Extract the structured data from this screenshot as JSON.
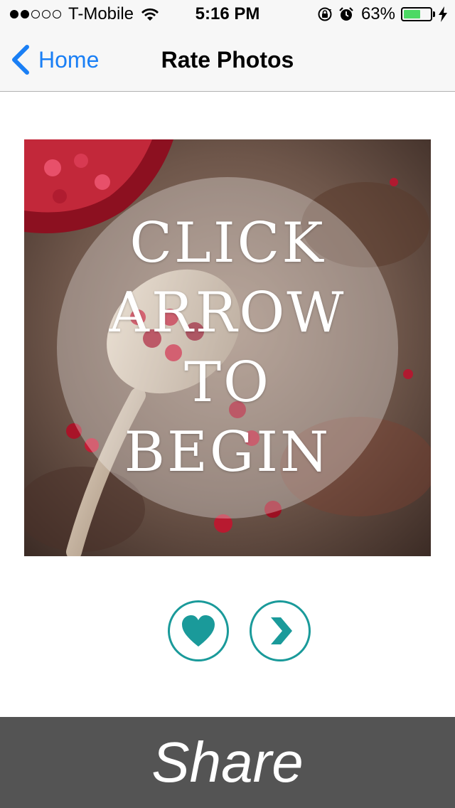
{
  "status_bar": {
    "signal_dots_filled": 2,
    "signal_dots_total": 5,
    "carrier": "T-Mobile",
    "time": "5:16 PM",
    "battery_percent": "63%",
    "battery_level": 0.63,
    "icons": [
      "wifi-icon",
      "rotation-lock-icon",
      "alarm-icon",
      "battery-icon",
      "charging-bolt-icon"
    ]
  },
  "nav": {
    "back_label": "Home",
    "title": "Rate Photos"
  },
  "photo": {
    "overlay_lines": [
      "CLICK",
      "ARROW",
      "TO",
      "BEGIN"
    ]
  },
  "actions": {
    "like_icon": "heart-icon",
    "next_icon": "chevron-right-icon",
    "accent_color": "#1a9a9a"
  },
  "footer": {
    "share_label": "Share"
  },
  "colors": {
    "nav_tint": "#1a7ff5",
    "footer_bg": "#545454",
    "battery_fill": "#4cd964"
  }
}
